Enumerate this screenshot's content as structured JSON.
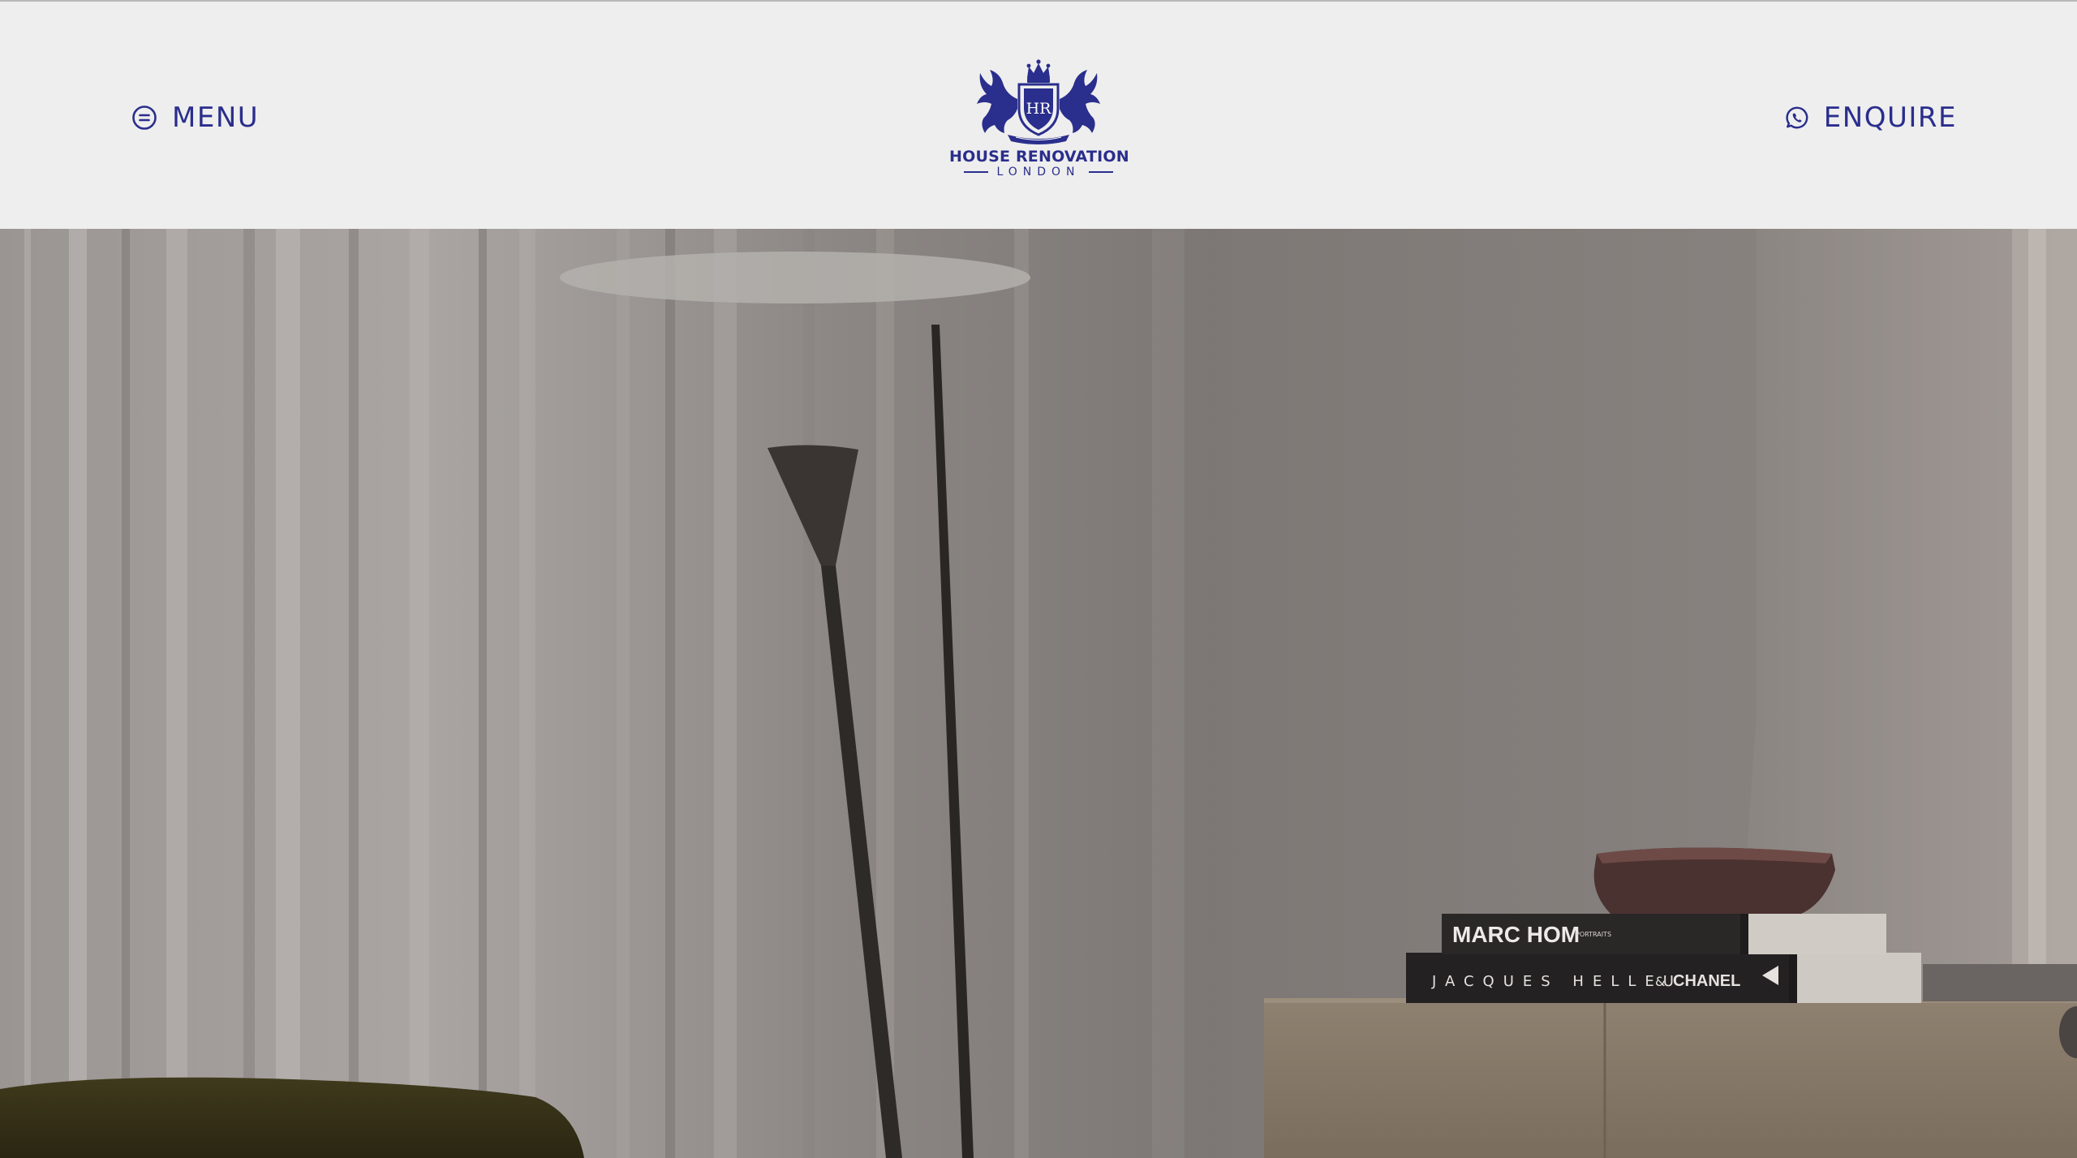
{
  "header": {
    "menu_label": "MENU",
    "enquire_label": "ENQUIRE",
    "menu_icon": "hamburger-circle-icon",
    "enquire_icon": "whatsapp-icon"
  },
  "logo": {
    "monogram": "HR",
    "name": "HOUSE RENOVATION",
    "subtitle": "LONDON",
    "brand_color": "#2a2e8c"
  },
  "hero": {
    "book_top_title": "MARC HOM",
    "book_top_subtitle": "PORTRAITS",
    "book_bottom_title": "JACQUES HELLEU",
    "book_bottom_amp": "&",
    "book_bottom_brand": "CHANEL"
  }
}
